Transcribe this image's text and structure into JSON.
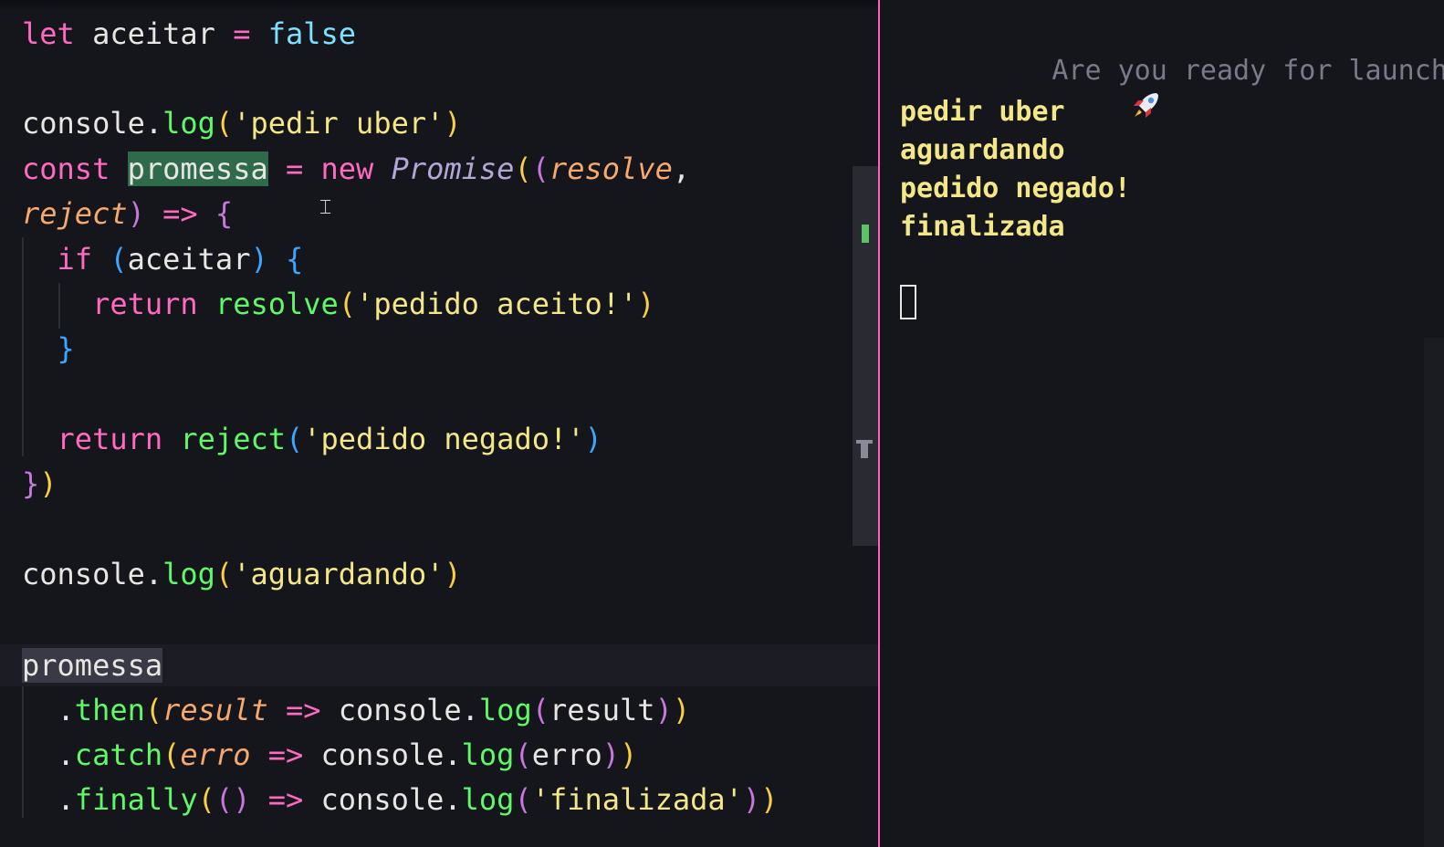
{
  "editor": {
    "lines": {
      "l1": [
        {
          "t": "let",
          "c": "kw"
        },
        {
          "t": " aceitar ",
          "c": "var"
        },
        {
          "t": "=",
          "c": "op"
        },
        {
          "t": " ",
          "c": "var"
        },
        {
          "t": "false",
          "c": "bool"
        }
      ],
      "l3": [
        {
          "t": "console",
          "c": "var"
        },
        {
          "t": ".",
          "c": "punc"
        },
        {
          "t": "log",
          "c": "fn"
        },
        {
          "t": "(",
          "c": "p1"
        },
        {
          "t": "'pedir uber'",
          "c": "str"
        },
        {
          "t": ")",
          "c": "p1"
        }
      ],
      "l4": [
        {
          "t": "const",
          "c": "kw"
        },
        {
          "t": " ",
          "c": "var"
        },
        {
          "t": "promessa",
          "c": "var hl-sel"
        },
        {
          "t": " ",
          "c": "var"
        },
        {
          "t": "=",
          "c": "op"
        },
        {
          "t": " ",
          "c": "var"
        },
        {
          "t": "new",
          "c": "kw"
        },
        {
          "t": " ",
          "c": "var"
        },
        {
          "t": "Promise",
          "c": "cls"
        },
        {
          "t": "(",
          "c": "p1"
        },
        {
          "t": "(",
          "c": "p2"
        },
        {
          "t": "resolve",
          "c": "par"
        },
        {
          "t": ",",
          "c": "punc"
        }
      ],
      "l5": [
        {
          "t": "reject",
          "c": "par"
        },
        {
          "t": ")",
          "c": "p2"
        },
        {
          "t": " ",
          "c": "var"
        },
        {
          "t": "=>",
          "c": "op"
        },
        {
          "t": " ",
          "c": "var"
        },
        {
          "t": "{",
          "c": "p2"
        }
      ],
      "l6": [
        {
          "t": "  if ",
          "c": "kw"
        },
        {
          "t": "(",
          "c": "p3"
        },
        {
          "t": "aceitar",
          "c": "var"
        },
        {
          "t": ")",
          "c": "p3"
        },
        {
          "t": " ",
          "c": "var"
        },
        {
          "t": "{",
          "c": "p3"
        }
      ],
      "l7": [
        {
          "t": "    return ",
          "c": "kw"
        },
        {
          "t": "resolve",
          "c": "fn"
        },
        {
          "t": "(",
          "c": "p1"
        },
        {
          "t": "'pedido aceito!'",
          "c": "str"
        },
        {
          "t": ")",
          "c": "p1"
        }
      ],
      "l8": [
        {
          "t": "  ",
          "c": "var"
        },
        {
          "t": "}",
          "c": "p3"
        }
      ],
      "l10": [
        {
          "t": "  return ",
          "c": "kw"
        },
        {
          "t": "reject",
          "c": "fn"
        },
        {
          "t": "(",
          "c": "p3"
        },
        {
          "t": "'pedido negado!'",
          "c": "str"
        },
        {
          "t": ")",
          "c": "p3"
        }
      ],
      "l11": [
        {
          "t": "}",
          "c": "p2"
        },
        {
          "t": ")",
          "c": "p1"
        }
      ],
      "l13": [
        {
          "t": "console",
          "c": "var"
        },
        {
          "t": ".",
          "c": "punc"
        },
        {
          "t": "log",
          "c": "fn"
        },
        {
          "t": "(",
          "c": "p1"
        },
        {
          "t": "'aguardando'",
          "c": "str"
        },
        {
          "t": ")",
          "c": "p1"
        }
      ],
      "l15": [
        {
          "t": "promessa",
          "c": "var hl-cur"
        }
      ],
      "l16": [
        {
          "t": "  .",
          "c": "punc"
        },
        {
          "t": "then",
          "c": "fn"
        },
        {
          "t": "(",
          "c": "p1"
        },
        {
          "t": "result",
          "c": "par"
        },
        {
          "t": " ",
          "c": "var"
        },
        {
          "t": "=>",
          "c": "op"
        },
        {
          "t": " console",
          "c": "var"
        },
        {
          "t": ".",
          "c": "punc"
        },
        {
          "t": "log",
          "c": "fn"
        },
        {
          "t": "(",
          "c": "p2"
        },
        {
          "t": "result",
          "c": "var"
        },
        {
          "t": ")",
          "c": "p2"
        },
        {
          "t": ")",
          "c": "p1"
        }
      ],
      "l17": [
        {
          "t": "  .",
          "c": "punc"
        },
        {
          "t": "catch",
          "c": "fn"
        },
        {
          "t": "(",
          "c": "p1"
        },
        {
          "t": "erro",
          "c": "par"
        },
        {
          "t": " ",
          "c": "var"
        },
        {
          "t": "=>",
          "c": "op"
        },
        {
          "t": " console",
          "c": "var"
        },
        {
          "t": ".",
          "c": "punc"
        },
        {
          "t": "log",
          "c": "fn"
        },
        {
          "t": "(",
          "c": "p2"
        },
        {
          "t": "erro",
          "c": "var"
        },
        {
          "t": ")",
          "c": "p2"
        },
        {
          "t": ")",
          "c": "p1"
        }
      ],
      "l18": [
        {
          "t": "  .",
          "c": "punc"
        },
        {
          "t": "finally",
          "c": "fn"
        },
        {
          "t": "(",
          "c": "p1"
        },
        {
          "t": "(",
          "c": "p2"
        },
        {
          "t": ")",
          "c": "p2"
        },
        {
          "t": " ",
          "c": "var"
        },
        {
          "t": "=>",
          "c": "op"
        },
        {
          "t": " console",
          "c": "var"
        },
        {
          "t": ".",
          "c": "punc"
        },
        {
          "t": "log",
          "c": "fn"
        },
        {
          "t": "(",
          "c": "p2"
        },
        {
          "t": "'finalizada'",
          "c": "str"
        },
        {
          "t": ")",
          "c": "p2"
        },
        {
          "t": ")",
          "c": "p1"
        }
      ]
    }
  },
  "terminal": {
    "prompt_icon": "rocket-icon",
    "prompt_text": "Are you ready for launch?",
    "output": [
      "pedir uber",
      "aguardando",
      "pedido negado!",
      "finalizada"
    ]
  },
  "colors": {
    "keyword": "#ff6ac1",
    "function": "#5ff967",
    "string": "#f3e787",
    "divider": "#ff61b4",
    "terminal_output": "#f3e787"
  }
}
